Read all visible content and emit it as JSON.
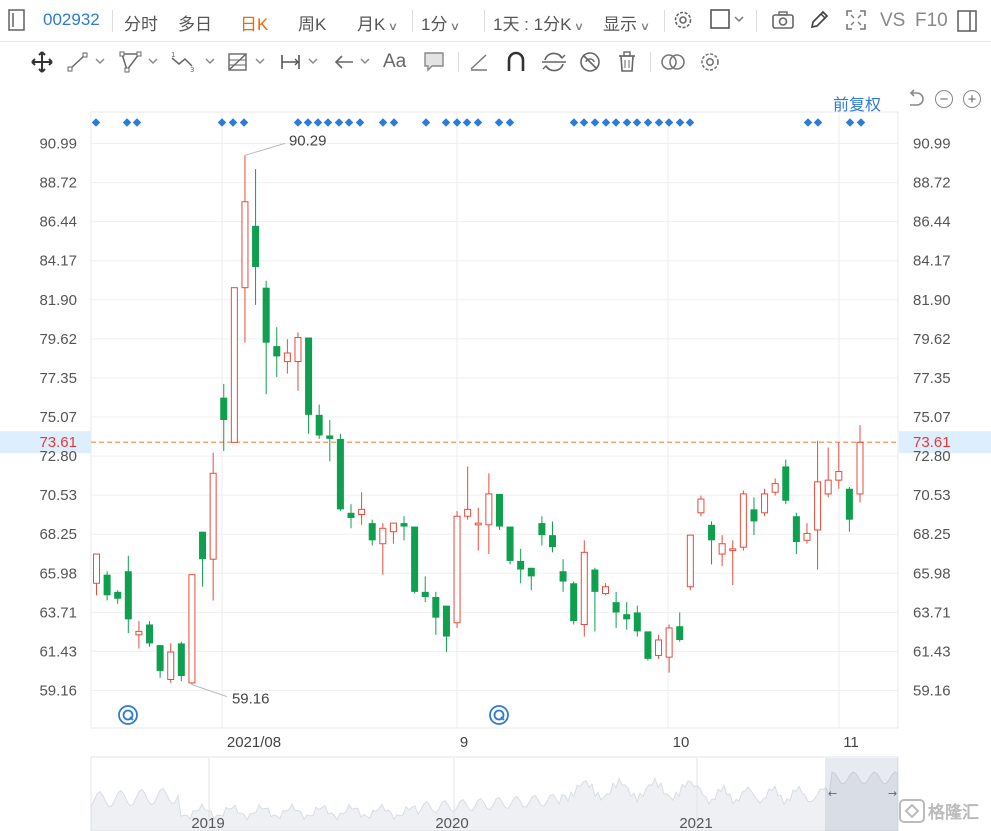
{
  "topbar": {
    "menu_icon": "sidebar-toggle-icon",
    "stock_code": "002932",
    "tabs": [
      "分时",
      "多日",
      "日K",
      "周K",
      "月K"
    ],
    "active_tab": "日K",
    "period": "1分",
    "multi_period": "1天 : 1分K",
    "display": "显示",
    "right_items": [
      "settings-icon",
      "checkbox-icon",
      "camera-icon",
      "pencil-icon",
      "fullscreen-icon"
    ],
    "vs_label": "VS",
    "f10_label": "F10",
    "panel_icon": "panel-icon"
  },
  "toolbar": {
    "tools": [
      "move-icon",
      "line-icon",
      "polyline-icon",
      "wave-icon",
      "fibonacci-icon",
      "range-icon",
      "arrow-icon",
      "text-icon",
      "comment-icon",
      "eraser-icon",
      "magnet-icon",
      "sync-icon",
      "hide-icon",
      "trash-icon",
      "compare-icon",
      "settings-icon"
    ],
    "text_tool_label": "Aa"
  },
  "chart_header": {
    "adjust_label": "前复权",
    "undo_icon": "undo-icon",
    "zoom_out_icon": "zoom-out-icon",
    "zoom_in_icon": "zoom-in-icon"
  },
  "chart_data": {
    "type": "candlestick",
    "y_ticks": [
      "90.99",
      "88.72",
      "86.44",
      "84.17",
      "81.90",
      "79.62",
      "77.35",
      "75.07",
      "72.80",
      "70.53",
      "68.25",
      "65.98",
      "63.71",
      "61.43",
      "59.16"
    ],
    "ylim": [
      58.2,
      92.3
    ],
    "current_price": 73.61,
    "current_price_label": "73.61",
    "max_label": "90.29",
    "min_label": "59.16",
    "x_labels": [
      "2021/08",
      "9",
      "10",
      "11"
    ],
    "candles": [
      {
        "o": 65.4,
        "c": 67.1,
        "h": 67.1,
        "l": 64.7
      },
      {
        "o": 65.9,
        "c": 64.7,
        "h": 66.1,
        "l": 64.4
      },
      {
        "o": 64.9,
        "c": 64.5,
        "h": 65.0,
        "l": 64.2
      },
      {
        "o": 66.1,
        "c": 63.3,
        "h": 67.0,
        "l": 62.5
      },
      {
        "o": 62.4,
        "c": 62.6,
        "h": 63.2,
        "l": 61.6
      },
      {
        "o": 63.0,
        "c": 61.9,
        "h": 63.2,
        "l": 61.7
      },
      {
        "o": 61.8,
        "c": 60.3,
        "h": 61.8,
        "l": 59.9
      },
      {
        "o": 59.8,
        "c": 61.4,
        "h": 61.9,
        "l": 59.6
      },
      {
        "o": 61.9,
        "c": 60.0,
        "h": 62.0,
        "l": 59.7
      },
      {
        "o": 59.6,
        "c": 65.9,
        "h": 65.9,
        "l": 59.5
      },
      {
        "o": 68.4,
        "c": 66.8,
        "h": 68.4,
        "l": 65.2
      },
      {
        "o": 66.8,
        "c": 71.8,
        "h": 73.0,
        "l": 64.4
      },
      {
        "o": 76.2,
        "c": 74.9,
        "h": 77.0,
        "l": 73.1
      },
      {
        "o": 73.6,
        "c": 82.6,
        "h": 82.6,
        "l": 73.6
      },
      {
        "o": 82.6,
        "c": 87.6,
        "h": 90.3,
        "l": 79.4
      },
      {
        "o": 86.2,
        "c": 83.8,
        "h": 89.5,
        "l": 81.6
      },
      {
        "o": 82.6,
        "c": 79.4,
        "h": 83.0,
        "l": 76.4
      },
      {
        "o": 79.2,
        "c": 78.6,
        "h": 80.3,
        "l": 77.4
      },
      {
        "o": 78.3,
        "c": 78.8,
        "h": 79.6,
        "l": 77.6
      },
      {
        "o": 78.3,
        "c": 79.7,
        "h": 80.0,
        "l": 76.6
      },
      {
        "o": 79.7,
        "c": 75.2,
        "h": 79.7,
        "l": 74.1
      },
      {
        "o": 75.2,
        "c": 74.0,
        "h": 75.8,
        "l": 73.8
      },
      {
        "o": 74.0,
        "c": 73.8,
        "h": 74.9,
        "l": 72.5
      },
      {
        "o": 73.8,
        "c": 69.7,
        "h": 74.1,
        "l": 69.6
      },
      {
        "o": 69.5,
        "c": 69.2,
        "h": 70.0,
        "l": 68.6
      },
      {
        "o": 69.4,
        "c": 69.7,
        "h": 70.7,
        "l": 68.8
      },
      {
        "o": 68.9,
        "c": 67.9,
        "h": 69.1,
        "l": 67.6
      },
      {
        "o": 67.7,
        "c": 68.6,
        "h": 68.9,
        "l": 65.9
      },
      {
        "o": 68.4,
        "c": 68.9,
        "h": 68.9,
        "l": 67.7
      },
      {
        "o": 68.9,
        "c": 68.7,
        "h": 69.3,
        "l": 67.9
      },
      {
        "o": 68.7,
        "c": 64.9,
        "h": 68.7,
        "l": 64.8
      },
      {
        "o": 64.9,
        "c": 64.6,
        "h": 65.8,
        "l": 64.3
      },
      {
        "o": 64.6,
        "c": 63.4,
        "h": 64.9,
        "l": 62.4
      },
      {
        "o": 64.1,
        "c": 62.3,
        "h": 64.1,
        "l": 61.4
      },
      {
        "o": 63.1,
        "c": 69.3,
        "h": 69.6,
        "l": 62.8
      },
      {
        "o": 69.3,
        "c": 69.7,
        "h": 72.2,
        "l": 69.1
      },
      {
        "o": 68.8,
        "c": 68.9,
        "h": 69.8,
        "l": 67.3
      },
      {
        "o": 68.8,
        "c": 70.6,
        "h": 71.8,
        "l": 67.1
      },
      {
        "o": 70.6,
        "c": 68.7,
        "h": 70.6,
        "l": 68.5
      },
      {
        "o": 68.7,
        "c": 66.7,
        "h": 68.7,
        "l": 66.5
      },
      {
        "o": 66.7,
        "c": 66.2,
        "h": 67.4,
        "l": 65.4
      },
      {
        "o": 66.3,
        "c": 65.8,
        "h": 66.3,
        "l": 65.0
      },
      {
        "o": 68.9,
        "c": 68.2,
        "h": 69.3,
        "l": 67.6
      },
      {
        "o": 68.2,
        "c": 67.5,
        "h": 69.0,
        "l": 67.2
      },
      {
        "o": 66.1,
        "c": 65.5,
        "h": 66.8,
        "l": 64.9
      },
      {
        "o": 65.4,
        "c": 63.2,
        "h": 65.5,
        "l": 63.0
      },
      {
        "o": 63.0,
        "c": 67.2,
        "h": 67.9,
        "l": 62.3
      },
      {
        "o": 66.2,
        "c": 64.9,
        "h": 66.3,
        "l": 62.6
      },
      {
        "o": 64.8,
        "c": 65.2,
        "h": 65.4,
        "l": 64.7
      },
      {
        "o": 64.3,
        "c": 63.7,
        "h": 64.9,
        "l": 62.8
      },
      {
        "o": 63.6,
        "c": 63.3,
        "h": 64.3,
        "l": 62.7
      },
      {
        "o": 63.7,
        "c": 62.6,
        "h": 64.1,
        "l": 62.3
      },
      {
        "o": 62.6,
        "c": 61.0,
        "h": 62.6,
        "l": 60.9
      },
      {
        "o": 61.2,
        "c": 62.1,
        "h": 62.4,
        "l": 61.0
      },
      {
        "o": 61.1,
        "c": 62.8,
        "h": 63.0,
        "l": 60.2
      },
      {
        "o": 62.9,
        "c": 62.1,
        "h": 63.7,
        "l": 62.0
      },
      {
        "o": 65.2,
        "c": 68.2,
        "h": 68.2,
        "l": 65.0
      },
      {
        "o": 69.5,
        "c": 70.3,
        "h": 70.5,
        "l": 69.3
      },
      {
        "o": 68.8,
        "c": 67.9,
        "h": 69.0,
        "l": 66.5
      },
      {
        "o": 67.1,
        "c": 67.7,
        "h": 68.2,
        "l": 66.4
      },
      {
        "o": 67.3,
        "c": 67.4,
        "h": 67.9,
        "l": 65.3
      },
      {
        "o": 67.5,
        "c": 70.6,
        "h": 70.8,
        "l": 67.3
      },
      {
        "o": 69.7,
        "c": 69.0,
        "h": 70.4,
        "l": 68.2
      },
      {
        "o": 69.5,
        "c": 70.6,
        "h": 70.9,
        "l": 69.3
      },
      {
        "o": 70.7,
        "c": 71.2,
        "h": 71.5,
        "l": 70.5
      },
      {
        "o": 72.2,
        "c": 70.2,
        "h": 72.6,
        "l": 70.0
      },
      {
        "o": 69.3,
        "c": 67.8,
        "h": 69.5,
        "l": 67.1
      },
      {
        "o": 67.9,
        "c": 68.3,
        "h": 68.9,
        "l": 67.7
      },
      {
        "o": 68.5,
        "c": 71.3,
        "h": 73.7,
        "l": 66.2
      },
      {
        "o": 70.6,
        "c": 71.4,
        "h": 73.3,
        "l": 70.4
      },
      {
        "o": 71.4,
        "c": 71.9,
        "h": 73.6,
        "l": 70.9
      },
      {
        "o": 70.9,
        "c": 69.1,
        "h": 71.0,
        "l": 68.4
      },
      {
        "o": 70.6,
        "c": 73.6,
        "h": 74.6,
        "l": 70.1
      }
    ]
  },
  "event_markers": {
    "group_count": 12,
    "symbol": "◆"
  },
  "navigator": {
    "year_labels": [
      "2019",
      "2020",
      "2021"
    ],
    "left_arrow": "←",
    "right_arrow": "→"
  },
  "watermark": {
    "text": "格隆汇"
  },
  "colors": {
    "up": "#e74c3c",
    "down": "#0e9f4f",
    "accent": "#2e7bd6",
    "active_tab": "#ef6a00",
    "price_line": "#f08a3e"
  }
}
